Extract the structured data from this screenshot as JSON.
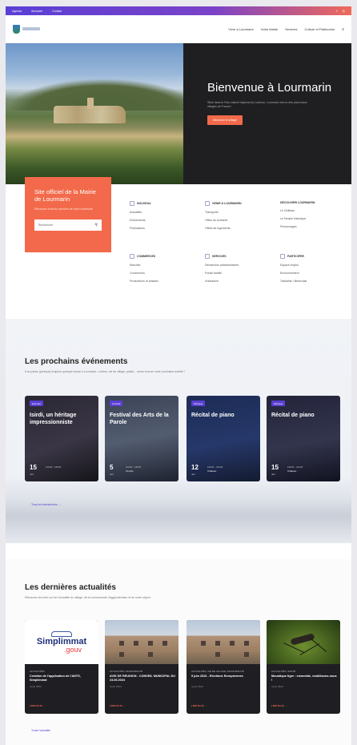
{
  "topbar": {
    "links": [
      "Agenda",
      "Annuaire",
      "Contact"
    ]
  },
  "nav": {
    "items": [
      "Vivre à Lourmarin",
      "Votre Mairie",
      "Services",
      "Culture et Patrimoine"
    ]
  },
  "hero": {
    "title": "Bienvenue à Lourmarin",
    "text": "Situé dans le Parc naturel régional du Luberon, Lourmarin est un des plus beaux villages de France !",
    "button": "Découvrir le village"
  },
  "mairie": {
    "title": "Site officiel de la Mairie de Lourmarin",
    "text": "Retrouvez tous les services de votre commune",
    "search_placeholder": "Rechercher"
  },
  "services": [
    {
      "title": "NOUVEAU",
      "items": [
        "Actualités",
        "Evènements",
        "Publications"
      ]
    },
    {
      "title": "VENIR À LOURMARIN",
      "items": [
        "Transports",
        "Office du tourisme",
        "Offres de logements"
      ]
    },
    {
      "title": "DÉCOUVRIR LOURMARIN",
      "items": [
        "Le Château",
        "Le Temple historique",
        "Personnages"
      ]
    },
    {
      "title": "COMMERCES",
      "items": [
        "Marchés",
        "Commerces",
        "Producteurs et artisans"
      ]
    },
    {
      "title": "SERVICES",
      "items": [
        "Démarches administratives",
        "Portail famille",
        "Urbanisme"
      ]
    },
    {
      "title": "PARTICIPER",
      "items": [
        "Espace emploi",
        "Environnement",
        "Trabalhar / Bénévolat"
      ]
    }
  ],
  "events": {
    "title": "Les prochains événements",
    "subtitle": "Il se passe (presque) toujours quelque chose à Lourmarin : culture, vie de village, plaisir... venez trouver votre prochaine activité !",
    "cards": [
      {
        "badge": "Expo/art",
        "title": "Isirdi, un héritage impressionniste",
        "day": "15",
        "month": "Juil",
        "time": "10h00 - 18h00",
        "place": ""
      },
      {
        "badge": "Festival",
        "title": "Festival des Arts de la Parole",
        "day": "5",
        "month": "Juil",
        "time": "10h00 - 18h00",
        "place": "Temple"
      },
      {
        "badge": "Musique",
        "title": "Récital de piano",
        "day": "12",
        "month": "Juil",
        "time": "19h00 - 21h00",
        "place": "Château"
      },
      {
        "badge": "Musique",
        "title": "Récital de piano",
        "day": "15",
        "month": "Juil",
        "time": "19h00 - 21h00",
        "place": "Château"
      }
    ],
    "all_link": "Tous les évènements →"
  },
  "news": {
    "title": "Les dernières actualités",
    "subtitle": "Retrouvez les infos au fort l'actualité du village, de la communauté d'agglomération et de notre région.",
    "cards": [
      {
        "category": "ACTUALITÉS",
        "title": "Création de l'application de l'ANTS, Simplimmat",
        "date": "4 juin 2024",
        "more": "LIRE PLUS →"
      },
      {
        "category": "ACTUALITÉS, MUNICIPALITÉ",
        "title": "AVIS DE REUNION - CONSEIL MUNICIPAL DU 24.06.2024",
        "date": "4 juin 2024",
        "more": "LIRE PLUS →"
      },
      {
        "category": "ACTUALITÉS, VIE DE VILLAGE, MUNICIPALITÉ",
        "title": "9 juin 2024 - Elections Européennes",
        "date": "4 juin 2024",
        "more": "LIRE PLUS →"
      },
      {
        "category": "ACTUALITÉS, SANTÉ",
        "title": "Moustique tigre : ensemble, mobilisons-nous !",
        "date": "4 juin 2024",
        "more": "LIRE PLUS →"
      }
    ],
    "simplimmat": {
      "big": "Simplimmat",
      "gouv": ".gouv"
    },
    "all_link": "Toute l'actualité"
  }
}
